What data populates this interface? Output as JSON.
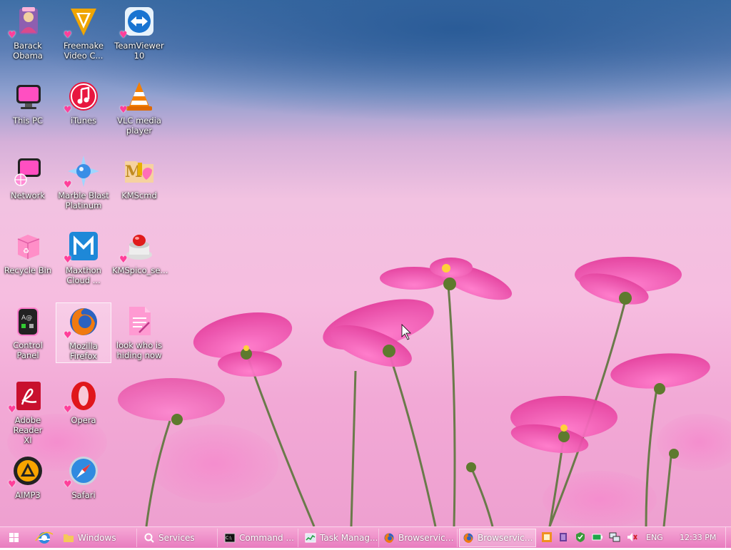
{
  "desktop": {
    "icons": [
      {
        "label": "Barack\nObama",
        "icon": "contact-icon",
        "shortcut": true
      },
      {
        "label": "This PC",
        "icon": "computer-icon",
        "shortcut": false
      },
      {
        "label": "Network",
        "icon": "network-icon",
        "shortcut": false
      },
      {
        "label": "Recycle Bin",
        "icon": "recycle-bin-icon",
        "shortcut": false
      },
      {
        "label": "Control Panel",
        "icon": "control-panel-icon",
        "shortcut": false
      },
      {
        "label": "Adobe Reader\nXI",
        "icon": "adobe-reader-icon",
        "shortcut": true
      },
      {
        "label": "AIMP3",
        "icon": "aimp-icon",
        "shortcut": true
      },
      {
        "label": "Freemake\nVideo C...",
        "icon": "freemake-icon",
        "shortcut": true
      },
      {
        "label": "iTunes",
        "icon": "itunes-icon",
        "shortcut": true
      },
      {
        "label": "Marble Blast\nPlatinum",
        "icon": "marble-blast-icon",
        "shortcut": true
      },
      {
        "label": "Maxthon\nCloud ...",
        "icon": "maxthon-icon",
        "shortcut": true
      },
      {
        "label": "Mozilla\nFirefox",
        "icon": "firefox-icon",
        "shortcut": true,
        "selected": true
      },
      {
        "label": "Opera",
        "icon": "opera-icon",
        "shortcut": true
      },
      {
        "label": "Safari",
        "icon": "safari-icon",
        "shortcut": true
      },
      {
        "label": "TeamViewer\n10",
        "icon": "teamviewer-icon",
        "shortcut": true
      },
      {
        "label": "VLC media\nplayer",
        "icon": "vlc-icon",
        "shortcut": true
      },
      {
        "label": "KMScmd",
        "icon": "kms-folder-icon",
        "shortcut": false
      },
      {
        "label": "KMSpico_se...",
        "icon": "kmspico-icon",
        "shortcut": true
      },
      {
        "label": "look who is\nhiding now",
        "icon": "text-file-icon",
        "shortcut": false
      }
    ]
  },
  "taskbar": {
    "start_icon": "windows-start-icon",
    "pinned_icon": "internet-explorer-icon",
    "tasks": [
      {
        "label": "Windows",
        "icon": "folder-icon"
      },
      {
        "label": "Services",
        "icon": "search-icon"
      },
      {
        "label": "Command ...",
        "icon": "command-prompt-icon"
      },
      {
        "label": "Task Manag...",
        "icon": "task-manager-icon"
      },
      {
        "label": "Browservice...",
        "icon": "firefox-icon"
      },
      {
        "label": "Browservice...",
        "icon": "firefox-icon",
        "active": true
      }
    ],
    "tray_icons": [
      "app-tray-icon",
      "square-tray-icon",
      "security-tray-icon",
      "battery-tray-icon",
      "network-tray-icon",
      "volume-muted-icon"
    ],
    "language": "ENG",
    "clock": "12:33 PM"
  },
  "colors": {
    "taskbar": "#ee8ccb",
    "shortcut_heart": "#ff3f9a",
    "label_text": "#ffffff"
  }
}
